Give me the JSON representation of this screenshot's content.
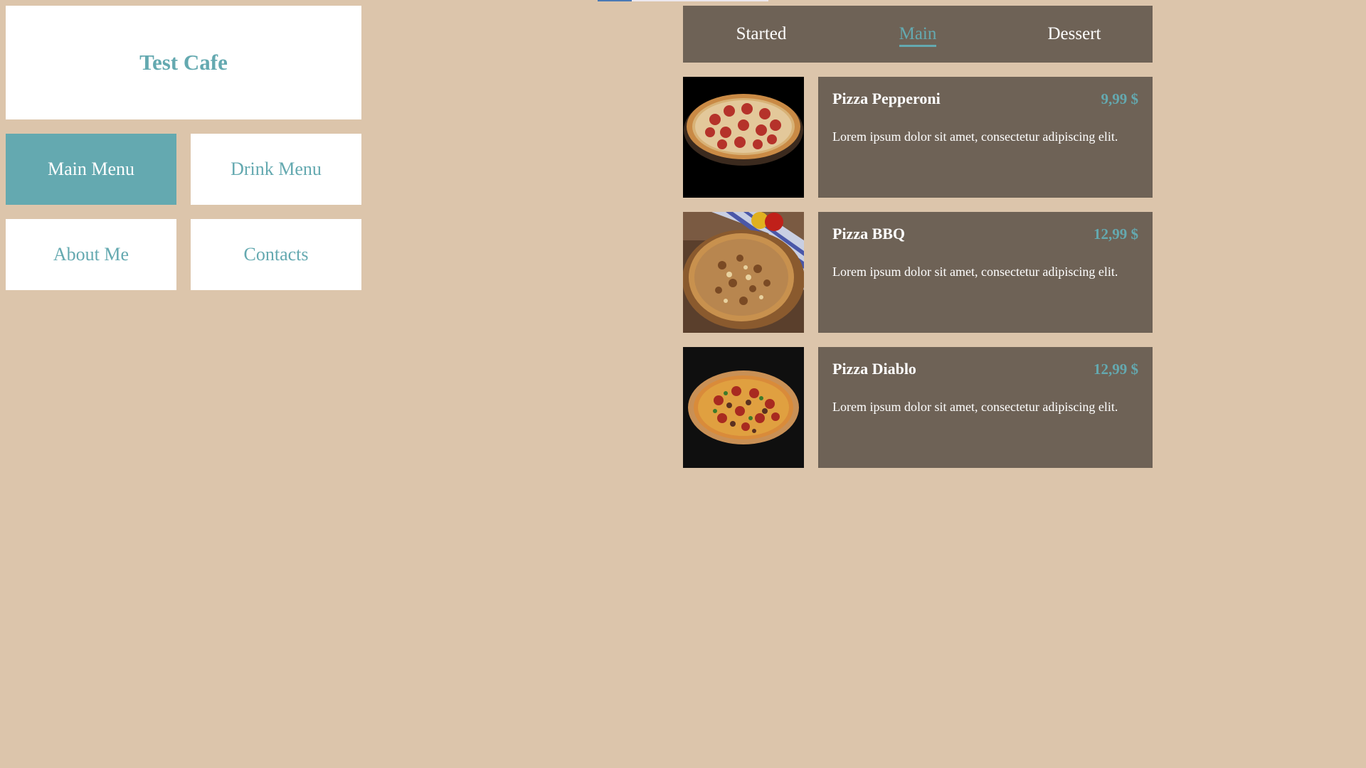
{
  "header": {
    "title": "Test Cafe"
  },
  "nav": {
    "main_menu": "Main Menu",
    "drink_menu": "Drink Menu",
    "about_me": "About Me",
    "contacts": "Contacts"
  },
  "tabs": [
    {
      "label": "Started"
    },
    {
      "label": "Main"
    },
    {
      "label": "Dessert"
    }
  ],
  "menu": {
    "items": [
      {
        "name": "Pizza Pepperoni",
        "price": "9,99 $",
        "description": "Lorem ipsum dolor sit amet, consectetur adipiscing elit.",
        "image": "pizza-pepperoni-image"
      },
      {
        "name": "Pizza BBQ",
        "price": "12,99 $",
        "description": "Lorem ipsum dolor sit amet, consectetur adipiscing elit.",
        "image": "pizza-bbq-image"
      },
      {
        "name": "Pizza Diablo",
        "price": "12,99 $",
        "description": "Lorem ipsum dolor sit amet, consectetur adipiscing elit.",
        "image": "pizza-diablo-image"
      }
    ]
  },
  "colors": {
    "background": "#dcc5ab",
    "accent": "#64a9b0",
    "panel": "#6e6256"
  }
}
